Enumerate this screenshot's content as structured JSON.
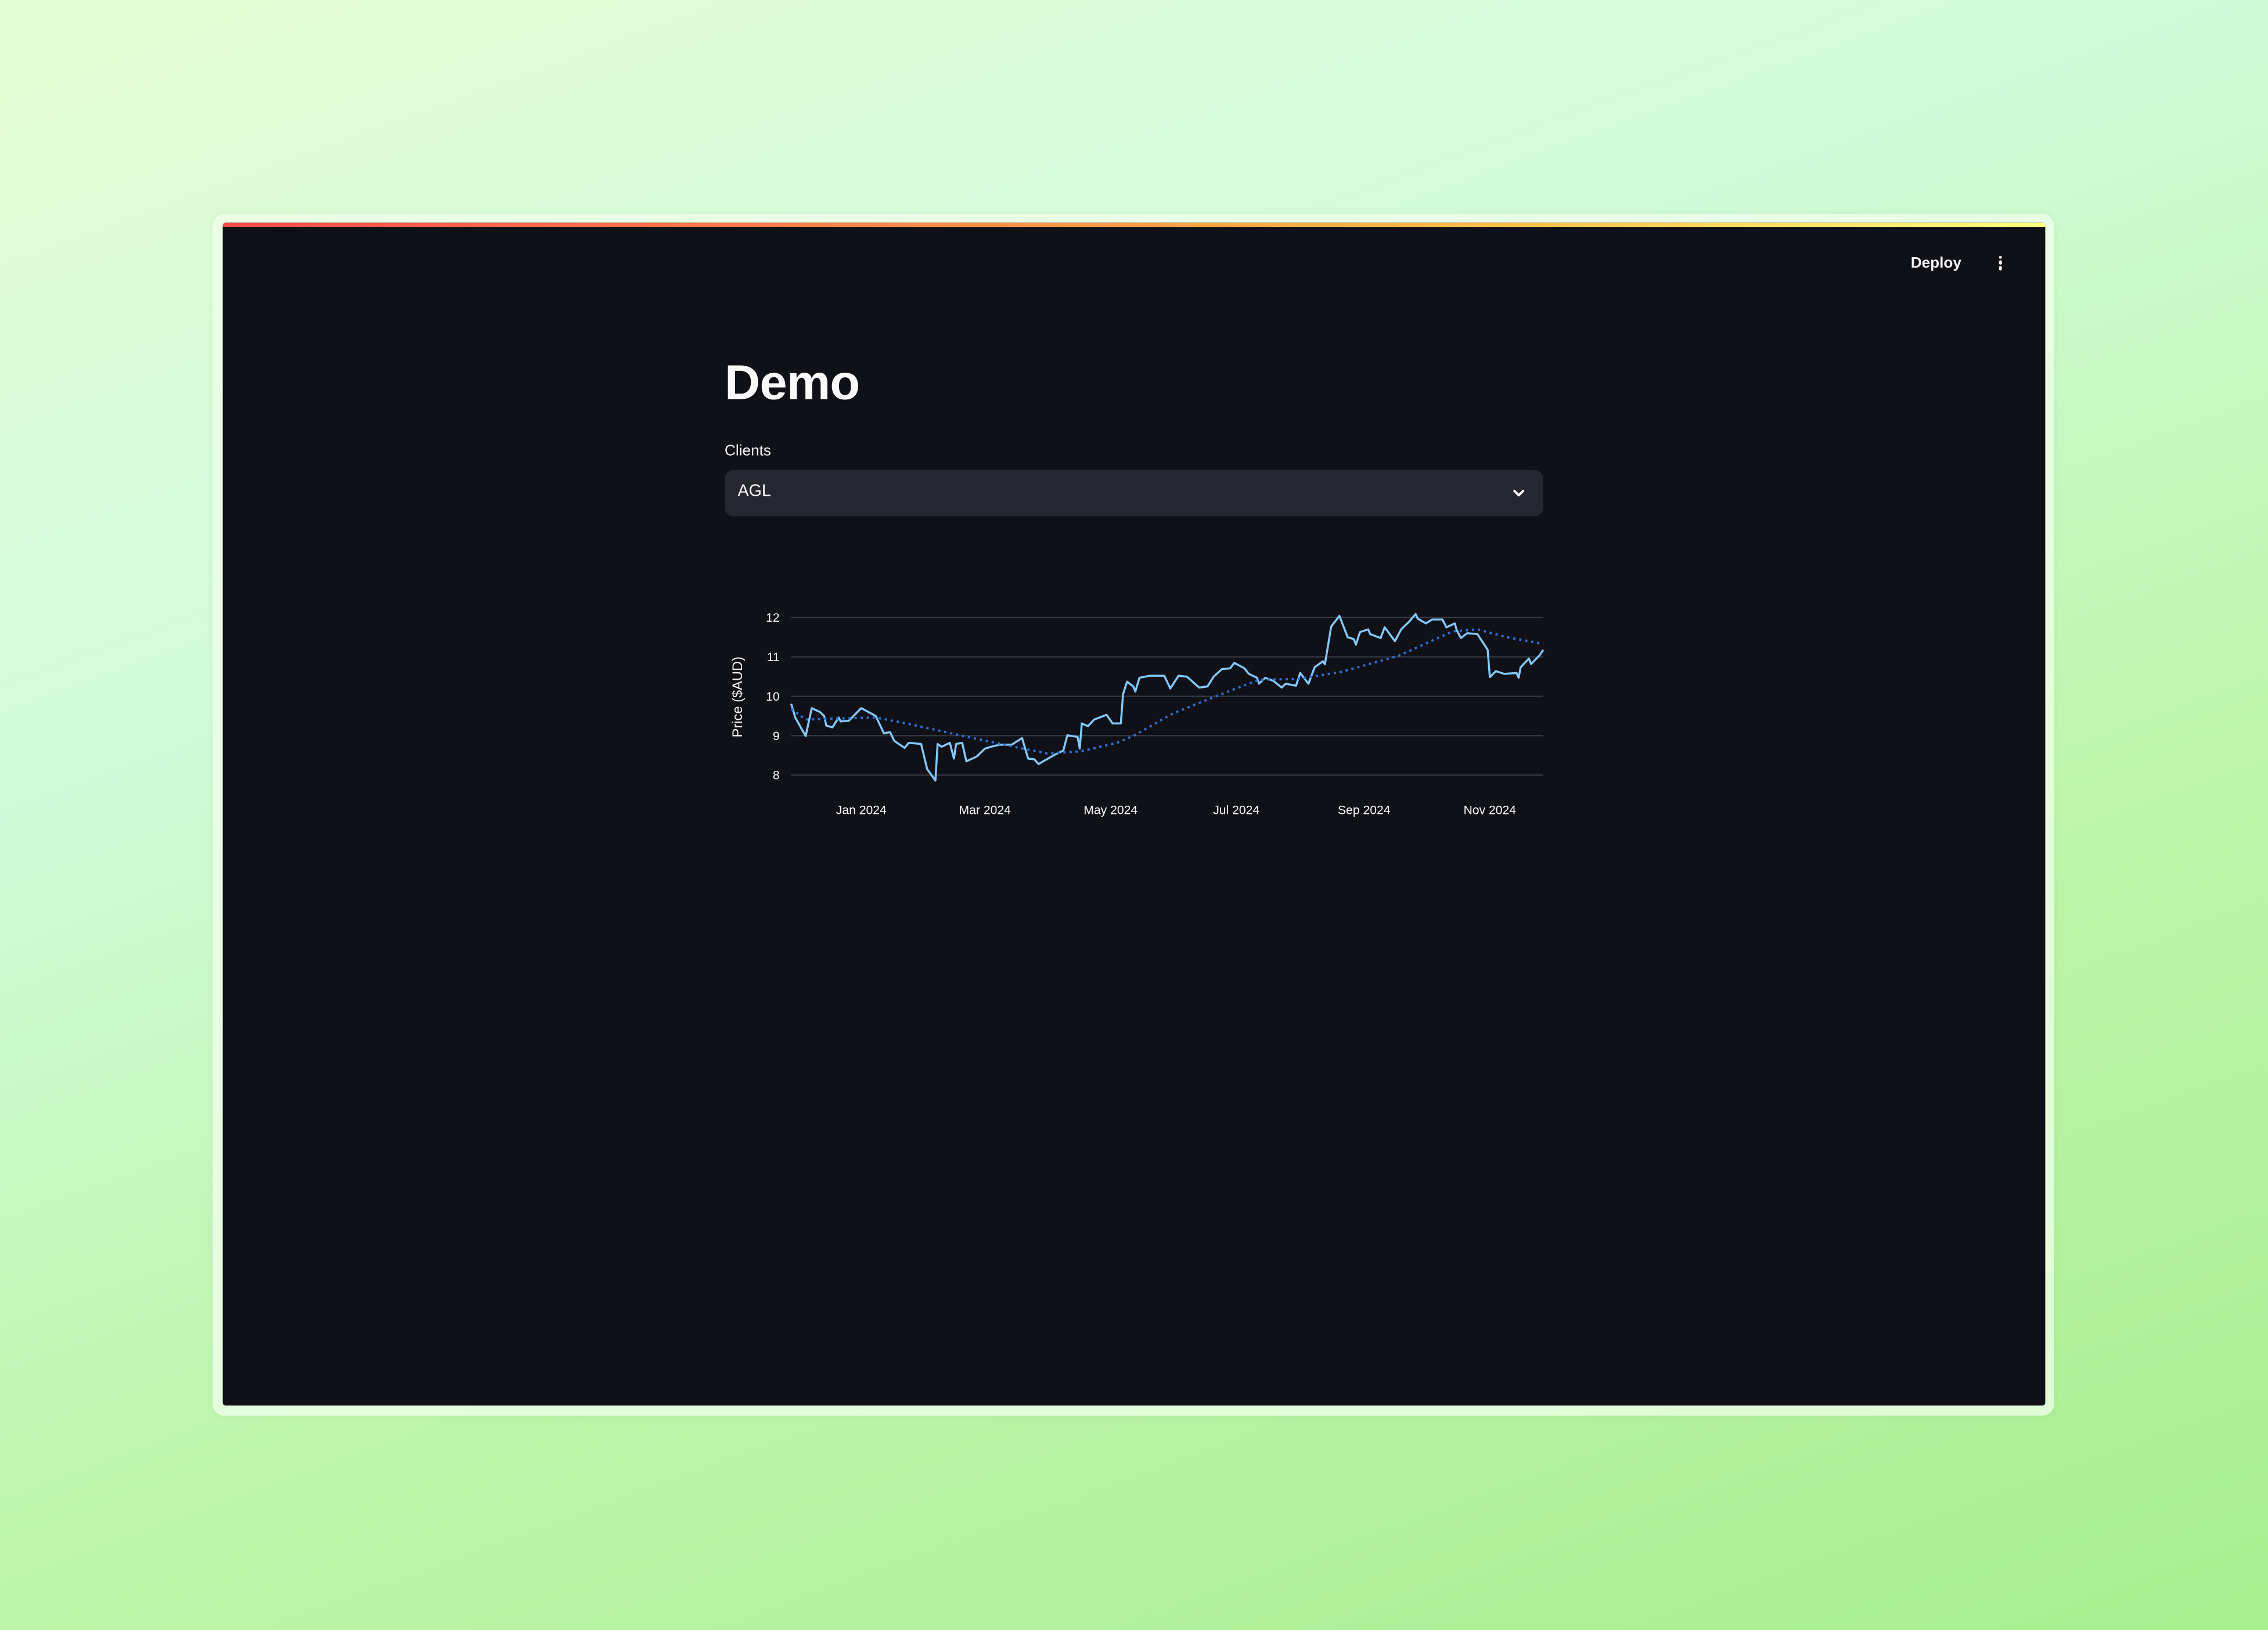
{
  "header": {
    "deploy_label": "Deploy",
    "menu_icon": "kebab-vertical-icon"
  },
  "colors": {
    "background": "#0f1117",
    "accent_bar": [
      "#ff4b4b",
      "#ffbd45",
      "#fffd80"
    ],
    "select_bg": "#262730",
    "price_line": "#83c9ff",
    "trend_line": "#2e6fd6",
    "grid": "#3a3d45"
  },
  "main": {
    "title": "Demo",
    "clients_select": {
      "label": "Clients",
      "value": "AGL",
      "icon": "chevron-down-icon"
    }
  },
  "chart_data": {
    "type": "line",
    "xlabel": "",
    "ylabel": "Price ($AUD)",
    "xlim": [
      "2023-11-28",
      "2024-11-27"
    ],
    "ylim": [
      7.6,
      12.5
    ],
    "grid": true,
    "yticks": [
      8,
      9,
      10,
      11,
      12
    ],
    "xticks": [
      {
        "date": "2024-01-01",
        "label": "Jan 2024"
      },
      {
        "date": "2024-03-01",
        "label": "Mar 2024"
      },
      {
        "date": "2024-05-01",
        "label": "May 2024"
      },
      {
        "date": "2024-07-01",
        "label": "Jul 2024"
      },
      {
        "date": "2024-09-01",
        "label": "Sep 2024"
      },
      {
        "date": "2024-11-01",
        "label": "Nov 2024"
      }
    ],
    "series": [
      {
        "style": "solid",
        "color": "#83c9ff",
        "points": [
          [
            "2023-11-28",
            9.81
          ],
          [
            "2023-11-30",
            9.46
          ],
          [
            "2023-12-05",
            8.99
          ],
          [
            "2023-12-08",
            9.7
          ],
          [
            "2023-12-12",
            9.6
          ],
          [
            "2023-12-14",
            9.5
          ],
          [
            "2023-12-15",
            9.26
          ],
          [
            "2023-12-18",
            9.21
          ],
          [
            "2023-12-21",
            9.46
          ],
          [
            "2023-12-22",
            9.36
          ],
          [
            "2023-12-26",
            9.38
          ],
          [
            "2024-01-01",
            9.7
          ],
          [
            "2024-01-08",
            9.5
          ],
          [
            "2024-01-12",
            9.06
          ],
          [
            "2024-01-15",
            9.09
          ],
          [
            "2024-01-17",
            8.87
          ],
          [
            "2024-01-22",
            8.69
          ],
          [
            "2024-01-24",
            8.82
          ],
          [
            "2024-01-30",
            8.79
          ],
          [
            "2024-02-02",
            8.15
          ],
          [
            "2024-02-06",
            7.86
          ],
          [
            "2024-02-07",
            8.79
          ],
          [
            "2024-02-09",
            8.72
          ],
          [
            "2024-02-13",
            8.82
          ],
          [
            "2024-02-15",
            8.42
          ],
          [
            "2024-02-16",
            8.79
          ],
          [
            "2024-02-19",
            8.82
          ],
          [
            "2024-02-21",
            8.35
          ],
          [
            "2024-02-26",
            8.47
          ],
          [
            "2024-03-01",
            8.67
          ],
          [
            "2024-03-04",
            8.72
          ],
          [
            "2024-03-08",
            8.77
          ],
          [
            "2024-03-14",
            8.77
          ],
          [
            "2024-03-19",
            8.94
          ],
          [
            "2024-03-22",
            8.42
          ],
          [
            "2024-03-25",
            8.4
          ],
          [
            "2024-03-27",
            8.28
          ],
          [
            "2024-03-30",
            8.37
          ],
          [
            "2024-04-04",
            8.52
          ],
          [
            "2024-04-08",
            8.62
          ],
          [
            "2024-04-10",
            9.01
          ],
          [
            "2024-04-15",
            8.97
          ],
          [
            "2024-04-16",
            8.67
          ],
          [
            "2024-04-17",
            9.31
          ],
          [
            "2024-04-20",
            9.24
          ],
          [
            "2024-04-23",
            9.41
          ],
          [
            "2024-04-29",
            9.53
          ],
          [
            "2024-05-02",
            9.31
          ],
          [
            "2024-05-06",
            9.31
          ],
          [
            "2024-05-07",
            10.05
          ],
          [
            "2024-05-09",
            10.37
          ],
          [
            "2024-05-12",
            10.25
          ],
          [
            "2024-05-13",
            10.12
          ],
          [
            "2024-05-15",
            10.47
          ],
          [
            "2024-05-20",
            10.52
          ],
          [
            "2024-05-27",
            10.52
          ],
          [
            "2024-05-30",
            10.2
          ],
          [
            "2024-06-03",
            10.52
          ],
          [
            "2024-06-07",
            10.5
          ],
          [
            "2024-06-13",
            10.22
          ],
          [
            "2024-06-17",
            10.25
          ],
          [
            "2024-06-20",
            10.5
          ],
          [
            "2024-06-24",
            10.69
          ],
          [
            "2024-06-28",
            10.71
          ],
          [
            "2024-06-30",
            10.85
          ],
          [
            "2024-07-05",
            10.71
          ],
          [
            "2024-07-07",
            10.57
          ],
          [
            "2024-07-11",
            10.47
          ],
          [
            "2024-07-12",
            10.32
          ],
          [
            "2024-07-15",
            10.47
          ],
          [
            "2024-07-19",
            10.39
          ],
          [
            "2024-07-23",
            10.22
          ],
          [
            "2024-07-25",
            10.32
          ],
          [
            "2024-07-30",
            10.27
          ],
          [
            "2024-08-01",
            10.59
          ],
          [
            "2024-08-05",
            10.32
          ],
          [
            "2024-08-08",
            10.74
          ],
          [
            "2024-08-12",
            10.89
          ],
          [
            "2024-08-13",
            10.81
          ],
          [
            "2024-08-16",
            11.77
          ],
          [
            "2024-08-20",
            12.04
          ],
          [
            "2024-08-24",
            11.5
          ],
          [
            "2024-08-27",
            11.45
          ],
          [
            "2024-08-28",
            11.31
          ],
          [
            "2024-08-30",
            11.63
          ],
          [
            "2024-09-03",
            11.7
          ],
          [
            "2024-09-04",
            11.58
          ],
          [
            "2024-09-09",
            11.48
          ],
          [
            "2024-09-11",
            11.75
          ],
          [
            "2024-09-16",
            11.4
          ],
          [
            "2024-09-19",
            11.7
          ],
          [
            "2024-09-23",
            11.9
          ],
          [
            "2024-09-26",
            12.09
          ],
          [
            "2024-09-27",
            11.97
          ],
          [
            "2024-10-01",
            11.85
          ],
          [
            "2024-10-04",
            11.95
          ],
          [
            "2024-10-09",
            11.95
          ],
          [
            "2024-10-11",
            11.75
          ],
          [
            "2024-10-15",
            11.85
          ],
          [
            "2024-10-16",
            11.67
          ],
          [
            "2024-10-18",
            11.48
          ],
          [
            "2024-10-21",
            11.6
          ],
          [
            "2024-10-26",
            11.58
          ],
          [
            "2024-10-31",
            11.18
          ],
          [
            "2024-11-01",
            10.49
          ],
          [
            "2024-11-04",
            10.64
          ],
          [
            "2024-11-08",
            10.57
          ],
          [
            "2024-11-14",
            10.59
          ],
          [
            "2024-11-15",
            10.47
          ],
          [
            "2024-11-16",
            10.74
          ],
          [
            "2024-11-20",
            10.96
          ],
          [
            "2024-11-21",
            10.82
          ],
          [
            "2024-11-25",
            11.03
          ],
          [
            "2024-11-27",
            11.18
          ]
        ]
      },
      {
        "style": "dotted",
        "color": "#2e6fd6",
        "points": [
          [
            "2023-11-28",
            9.68
          ],
          [
            "2023-12-05",
            9.41
          ],
          [
            "2023-12-18",
            9.43
          ],
          [
            "2024-01-08",
            9.46
          ],
          [
            "2024-01-23",
            9.31
          ],
          [
            "2024-02-18",
            9.01
          ],
          [
            "2024-03-15",
            8.72
          ],
          [
            "2024-03-31",
            8.55
          ],
          [
            "2024-04-16",
            8.6
          ],
          [
            "2024-05-04",
            8.82
          ],
          [
            "2024-05-12",
            8.99
          ],
          [
            "2024-05-31",
            9.56
          ],
          [
            "2024-06-26",
            10.1
          ],
          [
            "2024-07-12",
            10.42
          ],
          [
            "2024-07-31",
            10.44
          ],
          [
            "2024-08-21",
            10.62
          ],
          [
            "2024-09-18",
            11.03
          ],
          [
            "2024-10-14",
            11.65
          ],
          [
            "2024-10-26",
            11.7
          ],
          [
            "2024-11-09",
            11.5
          ],
          [
            "2024-11-27",
            11.33
          ]
        ]
      }
    ]
  }
}
